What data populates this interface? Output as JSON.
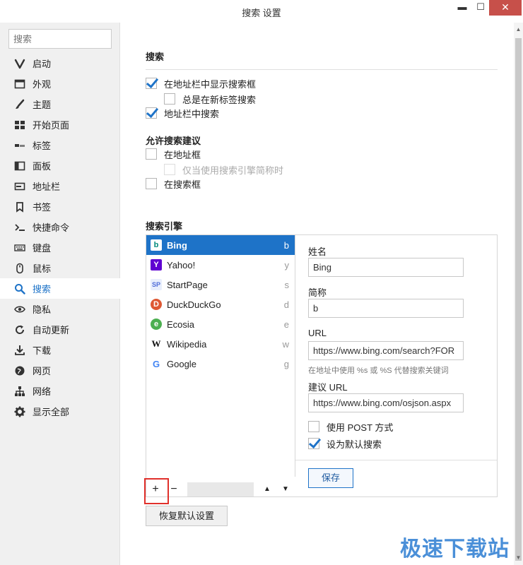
{
  "window": {
    "title": "搜索 设置",
    "min": "▬",
    "max": "☐",
    "close": "✕"
  },
  "sidebar": {
    "search_placeholder": "搜索",
    "items": [
      {
        "label": "启动",
        "icon": "vivaldi-logo-icon"
      },
      {
        "label": "外观",
        "icon": "window-icon"
      },
      {
        "label": "主题",
        "icon": "brush-icon"
      },
      {
        "label": "开始页面",
        "icon": "grid-icon"
      },
      {
        "label": "标签",
        "icon": "tabs-icon"
      },
      {
        "label": "面板",
        "icon": "panel-icon"
      },
      {
        "label": "地址栏",
        "icon": "address-bar-icon"
      },
      {
        "label": "书签",
        "icon": "bookmark-icon"
      },
      {
        "label": "快捷命令",
        "icon": "command-icon"
      },
      {
        "label": "键盘",
        "icon": "keyboard-icon"
      },
      {
        "label": "鼠标",
        "icon": "mouse-icon"
      },
      {
        "label": "搜索",
        "icon": "search-icon"
      },
      {
        "label": "隐私",
        "icon": "eye-icon"
      },
      {
        "label": "自动更新",
        "icon": "refresh-icon"
      },
      {
        "label": "下载",
        "icon": "download-icon"
      },
      {
        "label": "网页",
        "icon": "globe-icon"
      },
      {
        "label": "网络",
        "icon": "network-icon"
      },
      {
        "label": "显示全部",
        "icon": "gear-icon"
      }
    ],
    "active": "搜索"
  },
  "search_section": {
    "title": "搜索",
    "show_search_field": "在地址栏中显示搜索框",
    "always_new_tab": "总是在新标签搜索",
    "search_in_address": "地址栏中搜索"
  },
  "suggest_section": {
    "title": "允许搜索建议",
    "in_address": "在地址框",
    "only_nicknames": "仅当使用搜索引擎简称时",
    "in_search_field": "在搜索框"
  },
  "engines_section": {
    "title": "搜索引擎",
    "engines": [
      {
        "name": "Bing",
        "key": "b",
        "icon": "bing-logo-icon"
      },
      {
        "name": "Yahoo!",
        "key": "y",
        "icon": "yahoo-logo-icon"
      },
      {
        "name": "StartPage",
        "key": "s",
        "icon": "startpage-logo-icon"
      },
      {
        "name": "DuckDuckGo",
        "key": "d",
        "icon": "duckduckgo-logo-icon"
      },
      {
        "name": "Ecosia",
        "key": "e",
        "icon": "ecosia-logo-icon"
      },
      {
        "name": "Wikipedia",
        "key": "w",
        "icon": "wikipedia-logo-icon"
      },
      {
        "name": "Google",
        "key": "g",
        "icon": "google-logo-icon"
      }
    ],
    "toolbar": {
      "add": "+",
      "remove": "−",
      "up": "▲",
      "down": "▼"
    }
  },
  "detail": {
    "name_label": "姓名",
    "name_value": "Bing",
    "nickname_label": "简称",
    "nickname_value": "b",
    "url_label": "URL",
    "url_value": "https://www.bing.com/search?FOR",
    "url_hint": "在地址中使用 %s 或 %S 代替搜索关键词",
    "suggest_label": "建议 URL",
    "suggest_value": "https://www.bing.com/osjson.aspx",
    "use_post": "使用 POST 方式",
    "set_default": "设为默认搜索",
    "save": "保存"
  },
  "reset_button": "恢复默认设置",
  "watermark": "极速下载站",
  "colors": {
    "accent": "#1e73c8",
    "close": "#c7504a",
    "highlight": "#e0302b"
  }
}
